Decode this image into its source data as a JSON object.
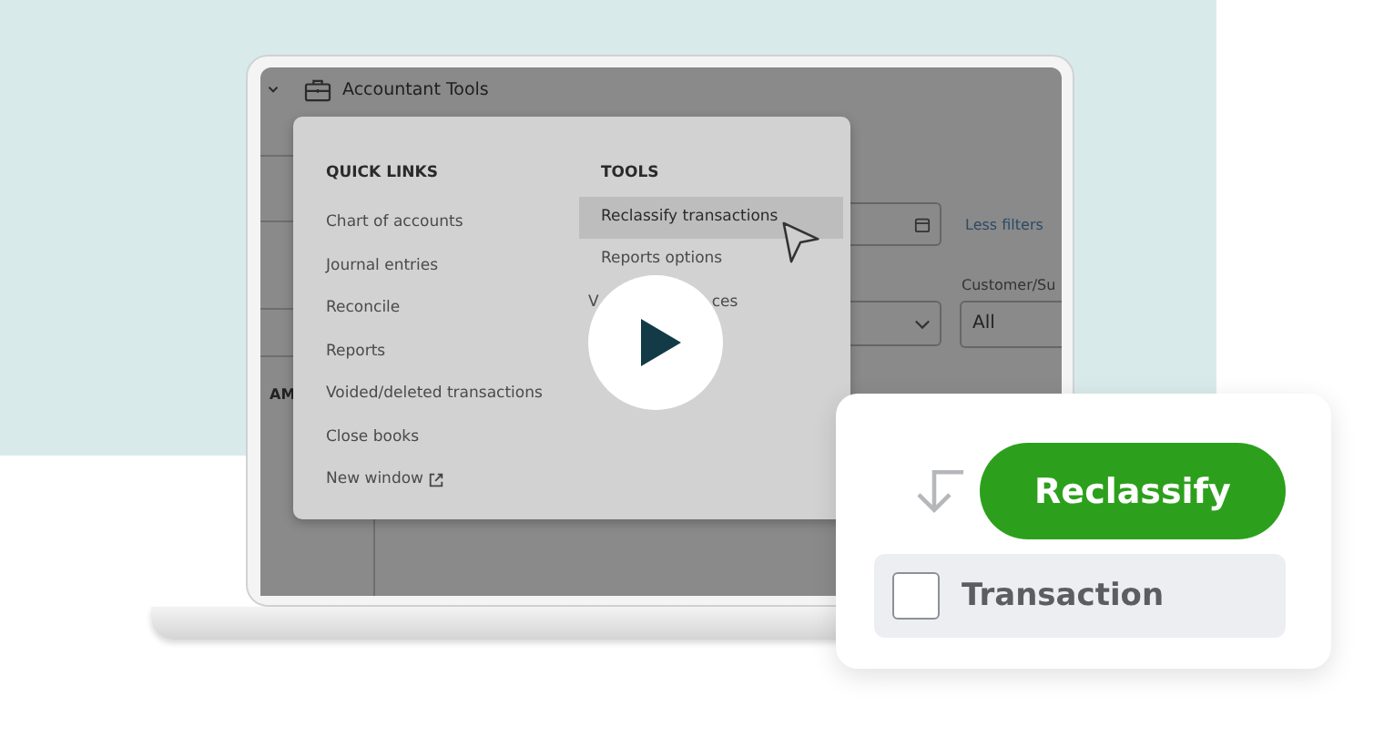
{
  "header": {
    "title": "Accountant Tools"
  },
  "background": {
    "table_header": "AM",
    "filter_link": "Less filters",
    "field_label": "Customer/Su",
    "field_value": "All"
  },
  "menu": {
    "sections": [
      {
        "heading": "QUICK LINKS",
        "items": [
          {
            "label": "Chart of accounts",
            "kind": "link",
            "selected": false
          },
          {
            "label": "Journal entries",
            "kind": "link",
            "selected": false
          },
          {
            "label": "Reconcile",
            "kind": "link",
            "selected": false
          },
          {
            "label": "Reports",
            "kind": "link",
            "selected": false
          },
          {
            "label": "Voided/deleted transactions",
            "kind": "link",
            "selected": false
          },
          {
            "label": "Close books",
            "kind": "link",
            "selected": false
          },
          {
            "label": "New window",
            "kind": "external",
            "selected": false
          }
        ]
      },
      {
        "heading": "TOOLS",
        "items": [
          {
            "label": "Reclassify transactions",
            "kind": "link",
            "selected": true
          },
          {
            "label": "Reports options",
            "kind": "link",
            "selected": false
          },
          {
            "label": "V",
            "label_end": "ces",
            "kind": "covered",
            "selected": false
          }
        ]
      }
    ]
  },
  "card": {
    "button": "Reclassify",
    "checkbox": {
      "label": "Transaction",
      "checked": false
    }
  }
}
